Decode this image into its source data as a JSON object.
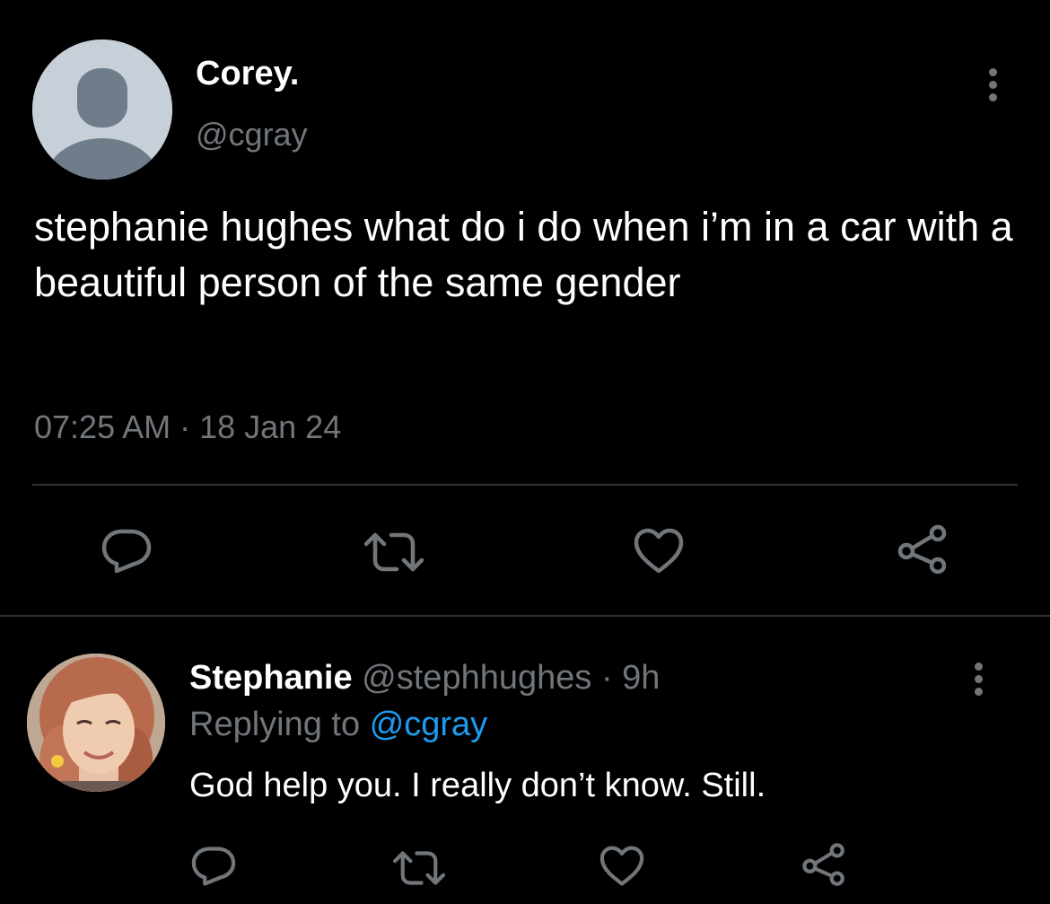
{
  "main_tweet": {
    "author_name": "Corey.",
    "author_handle": "@cgray",
    "text": "stephanie hughes what do i do when i’m in a car with a beautiful person of the same gender",
    "timestamp": "07:25 AM · 18 Jan 24",
    "icons": {
      "more": "more-vertical-icon",
      "reply": "reply-icon",
      "retweet": "retweet-icon",
      "like": "heart-icon",
      "share": "share-icon"
    }
  },
  "reply": {
    "author_name": "Stephanie",
    "author_handle": "@stephhughes",
    "time": "9h",
    "separator": "·",
    "replying_prefix": "Replying to",
    "replying_to": "@cgray",
    "text": "God help you. I really don’t know. Still."
  },
  "colors": {
    "background": "#000000",
    "text_primary": "#ffffff",
    "text_secondary": "#71767b",
    "link": "#1d9bf0",
    "divider": "#2f3336",
    "icon": "#71767b"
  }
}
